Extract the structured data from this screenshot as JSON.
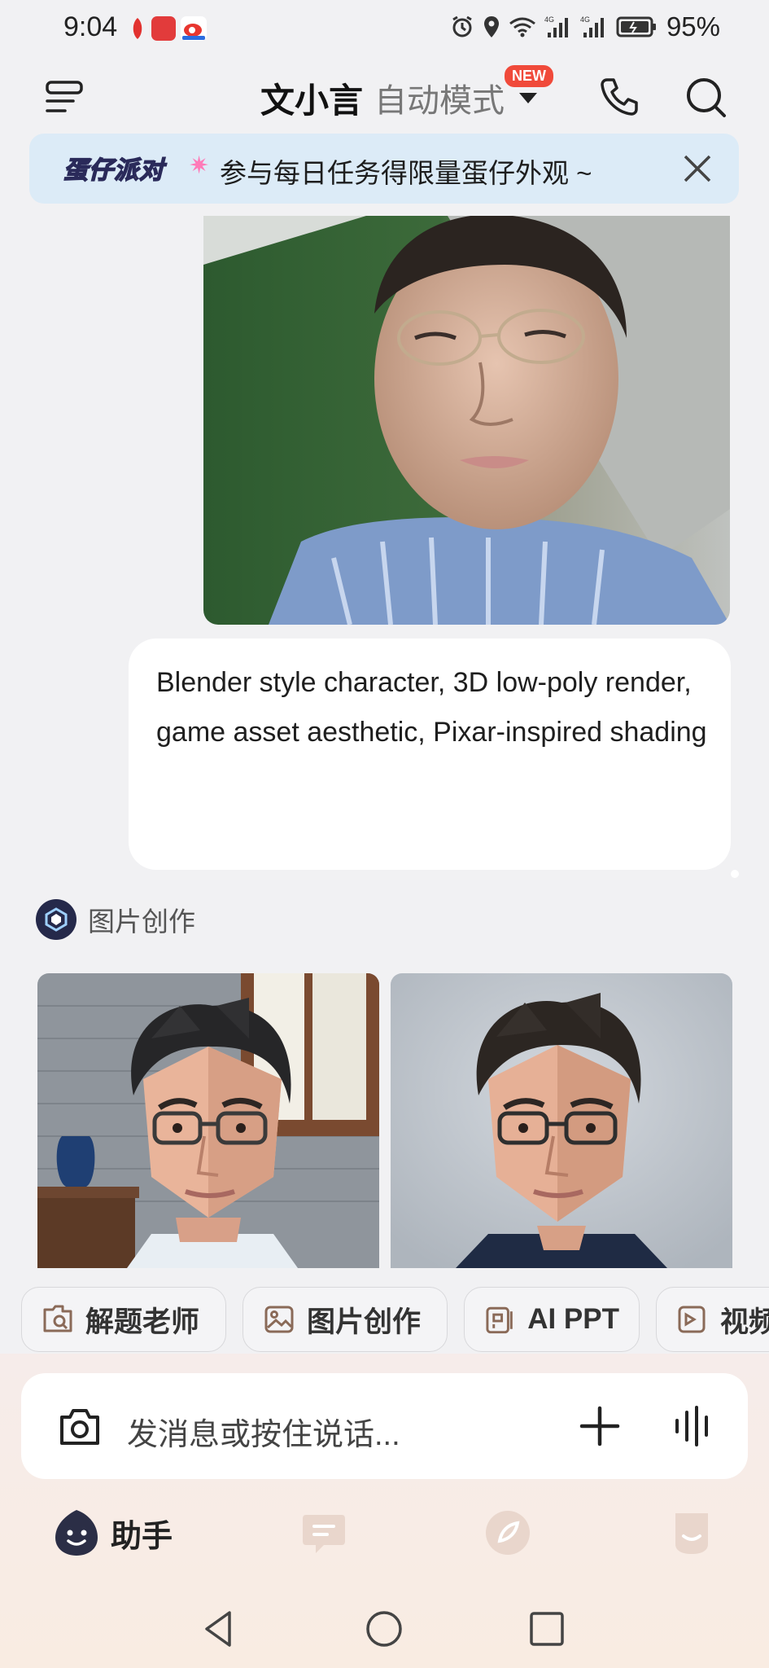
{
  "status_bar": {
    "time": "9:04",
    "battery": "95%",
    "network_1": "4G",
    "network_2": "4G"
  },
  "header": {
    "title": "文小言",
    "mode": "自动模式",
    "badge": "NEW"
  },
  "banner": {
    "logo": "蛋仔派对",
    "text": "参与每日任务得限量蛋仔外观 ~"
  },
  "chat": {
    "user_message": "Blender style character, 3D low-poly render,\ngame asset aesthetic, Pixar-inspired shading",
    "bot_name": "图片创作"
  },
  "chips": [
    {
      "label": "解题老师",
      "icon": "solve-icon"
    },
    {
      "label": "图片创作",
      "icon": "image-icon"
    },
    {
      "label": "AI PPT",
      "icon": "ppt-icon"
    },
    {
      "label": "视频",
      "icon": "video-icon"
    }
  ],
  "input": {
    "placeholder": "发消息或按住说话..."
  },
  "tabs": [
    {
      "label": "助手",
      "icon": "assistant-icon",
      "active": true
    },
    {
      "label": "",
      "icon": "chat-icon"
    },
    {
      "label": "",
      "icon": "discover-icon"
    },
    {
      "label": "",
      "icon": "profile-icon"
    }
  ],
  "colors": {
    "background": "#f1f1f3",
    "banner_bg": "#dcebf7",
    "badge": "#f04a3a",
    "bottom_bg": "#f7ece6"
  }
}
